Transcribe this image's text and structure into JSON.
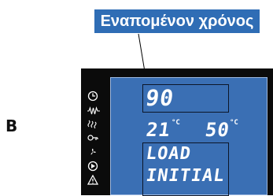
{
  "callout": {
    "label": "Εναπομένον χρόνος"
  },
  "section": {
    "letter": "B"
  },
  "display": {
    "time_value": "90",
    "temp1": {
      "value": "21",
      "unit": "°C"
    },
    "temp2": {
      "value": "50",
      "unit": "°C"
    },
    "message_line1": "LOAD",
    "message_line2": "INITIAL"
  },
  "icons": [
    "clock-icon",
    "heater-icon",
    "steam-icon",
    "key-icon",
    "fan-icon",
    "disc-icon",
    "warning-icon"
  ],
  "colors": {
    "callout_bg": "#2f6db5",
    "screen_bg": "#3a6fb4",
    "device_body": "#0b0b0b"
  }
}
